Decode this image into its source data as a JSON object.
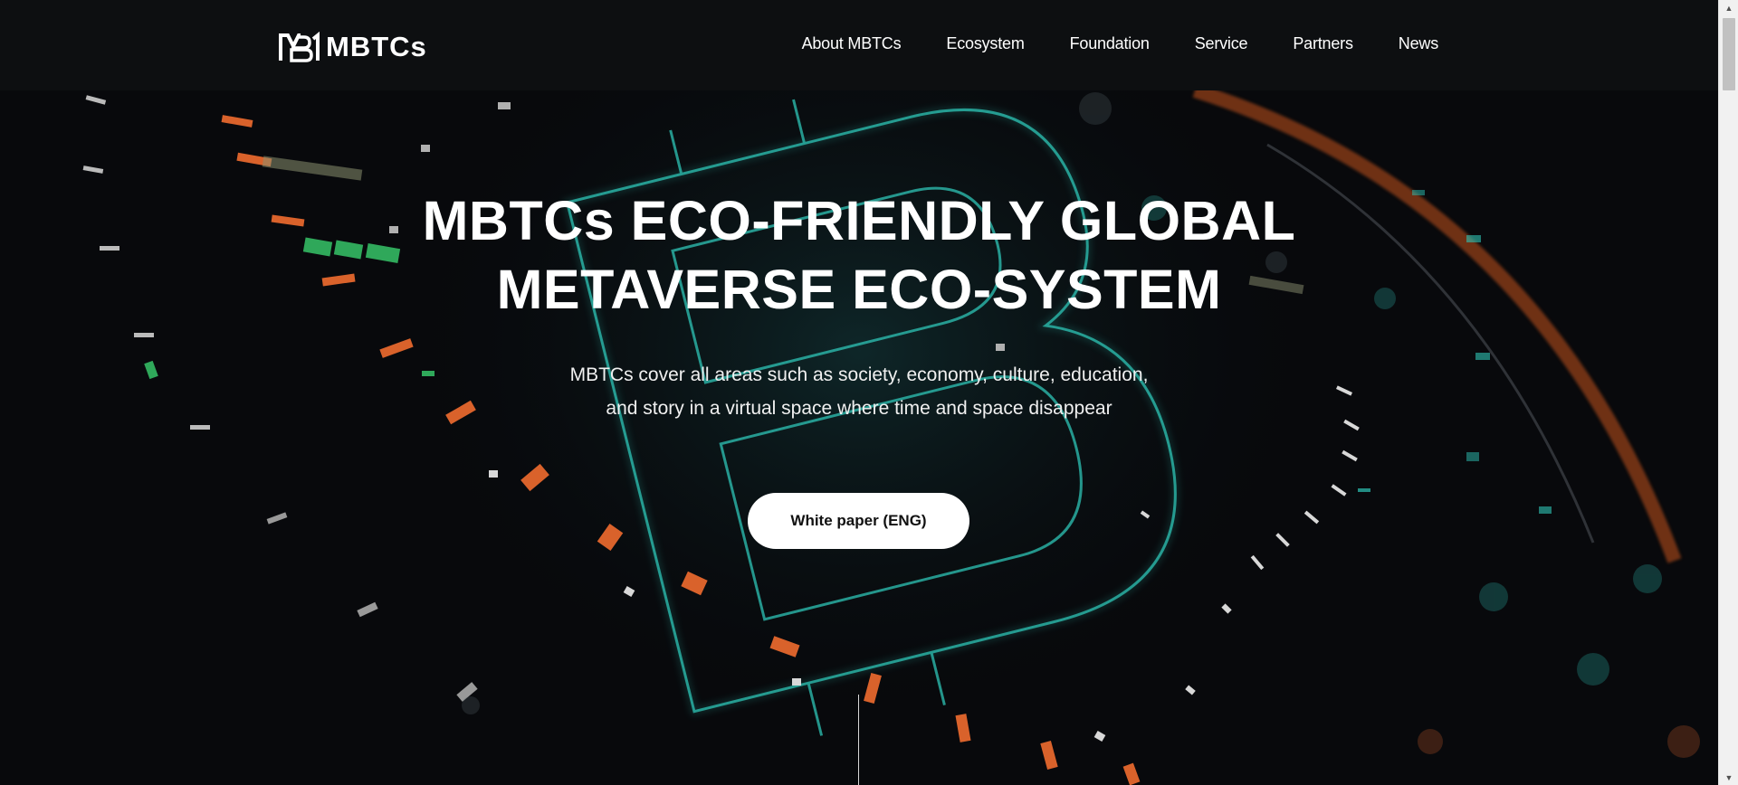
{
  "brand": {
    "name": "MBTCs"
  },
  "nav": {
    "items": [
      {
        "label": "About MBTCs"
      },
      {
        "label": "Ecosystem"
      },
      {
        "label": "Foundation"
      },
      {
        "label": "Service"
      },
      {
        "label": "Partners"
      },
      {
        "label": "News"
      }
    ]
  },
  "hero": {
    "title_line1": "MBTCs ECO-FRIENDLY GLOBAL",
    "title_line2": "METAVERSE ECO-SYSTEM",
    "subtitle_line1": "MBTCs cover all areas such as society, economy, culture, education,",
    "subtitle_line2": "and story in a virtual space where time and space disappear",
    "cta_label": "White paper (ENG)"
  },
  "colors": {
    "background": "#08090c",
    "header": "#0d0f11",
    "accent_teal": "#2ec4b6",
    "accent_orange": "#d9622b",
    "accent_green": "#2fa85a"
  },
  "scrollbar": {
    "up_icon": "triangle-up-icon",
    "down_icon": "triangle-down-icon"
  }
}
